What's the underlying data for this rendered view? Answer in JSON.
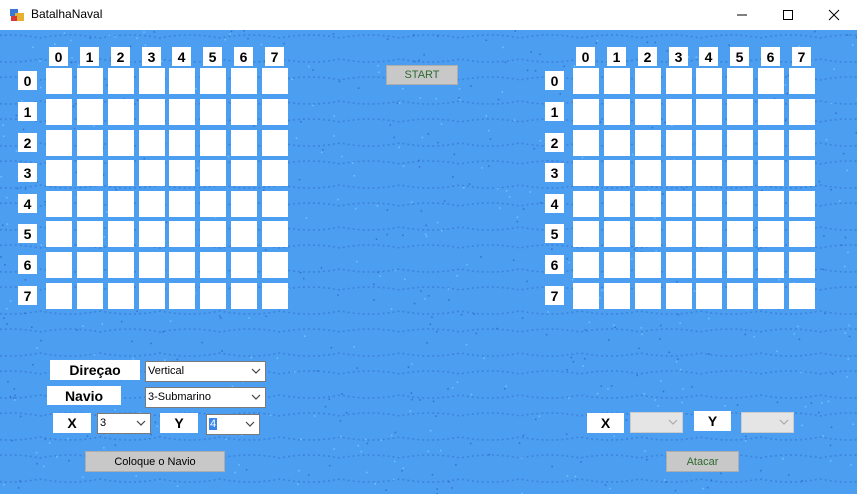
{
  "window": {
    "title": "BatalhaNaval",
    "icon": "app-window-icon",
    "controls": [
      "minimize-icon",
      "maximize-icon",
      "close-icon"
    ]
  },
  "start_button": "START",
  "grid_columns": [
    "0",
    "1",
    "2",
    "3",
    "4",
    "5",
    "6",
    "7"
  ],
  "grid_rows": [
    "0",
    "1",
    "2",
    "3",
    "4",
    "5",
    "6",
    "7"
  ],
  "placement": {
    "direction_label": "Direçao",
    "direction_value": "Vertical",
    "ship_label": "Navio",
    "ship_value": "3-Submarino",
    "x_label": "X",
    "x_value": "3",
    "y_label": "Y",
    "y_value": "4",
    "place_button": "Coloque o Navio"
  },
  "attack": {
    "x_label": "X",
    "x_value": "",
    "y_label": "Y",
    "y_value": "",
    "attack_button": "Atacar"
  },
  "colors": {
    "water": "#4c9ef0",
    "wave": "#2f6fd0",
    "cell": "#ffffff",
    "button": "#c8c8c8"
  }
}
